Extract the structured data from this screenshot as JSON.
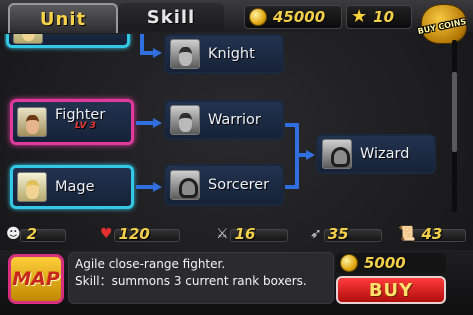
{
  "tabs": [
    {
      "label": "Unit",
      "active": true
    },
    {
      "label": "Skill",
      "active": false
    }
  ],
  "currency": {
    "coins": "45000",
    "stars": "10",
    "buy_coins_label": "BUY COINS"
  },
  "tree": {
    "nodes": [
      {
        "label": "Knight",
        "icon": "knight-portrait"
      },
      {
        "label": "Fighter",
        "level": "LV 3",
        "icon": "fighter-portrait",
        "selected": true
      },
      {
        "label": "Warrior",
        "icon": "warrior-portrait"
      },
      {
        "label": "Wizard",
        "icon": "wizard-portrait"
      },
      {
        "label": "Mage",
        "icon": "mage-portrait"
      },
      {
        "label": "Sorcerer",
        "icon": "sorcerer-portrait"
      }
    ]
  },
  "stats": [
    {
      "icon": "units-icon",
      "value": "2"
    },
    {
      "icon": "heart-icon",
      "value": "120"
    },
    {
      "icon": "sword-icon",
      "value": "16"
    },
    {
      "icon": "speed-icon",
      "value": "35"
    },
    {
      "icon": "scroll-icon",
      "value": "43"
    }
  ],
  "bottom": {
    "map_label": "MAP",
    "description_line1": "Agile close-range fighter.",
    "description_line2": "Skill：summons 3 current rank boxers.",
    "price": "5000",
    "buy_label": "BUY"
  },
  "colors": {
    "selected_border": "#e23a9c",
    "mage_border": "#33c9e6",
    "arrow": "#2f6fe0",
    "gold_text": "#f4d04a",
    "buy_button": "#d81c1c"
  }
}
